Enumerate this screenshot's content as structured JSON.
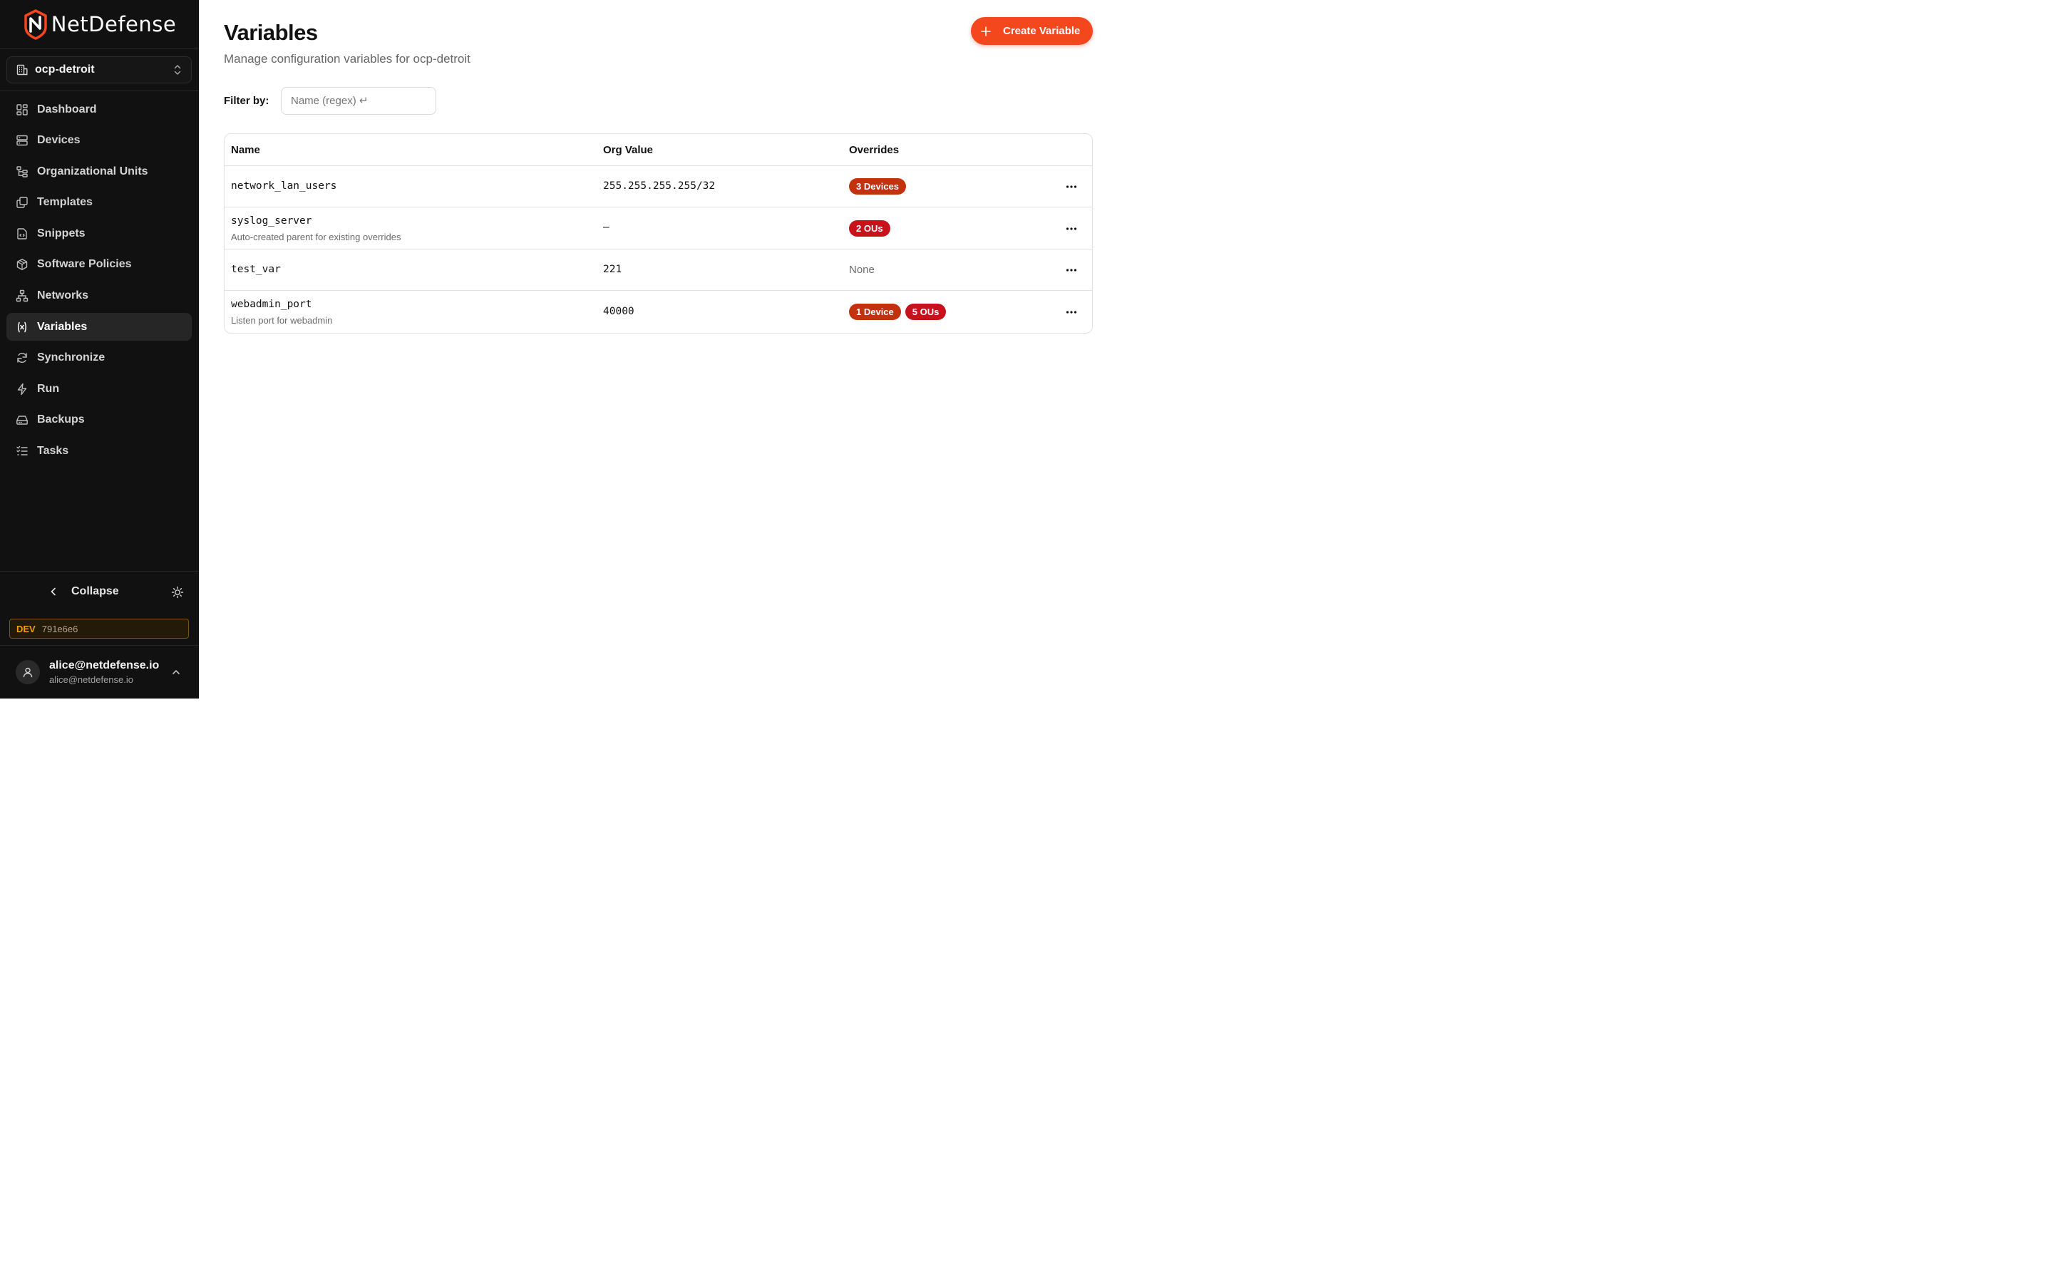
{
  "brand": {
    "name": "NetDefense"
  },
  "org_switcher": {
    "label": "ocp-detroit"
  },
  "nav": {
    "items": [
      {
        "label": "Dashboard",
        "icon": "dashboard-icon",
        "active": false
      },
      {
        "label": "Devices",
        "icon": "server-icon",
        "active": false
      },
      {
        "label": "Organizational Units",
        "icon": "tree-icon",
        "active": false
      },
      {
        "label": "Templates",
        "icon": "copy-icon",
        "active": false
      },
      {
        "label": "Snippets",
        "icon": "code-file-icon",
        "active": false
      },
      {
        "label": "Software Policies",
        "icon": "package-icon",
        "active": false
      },
      {
        "label": "Networks",
        "icon": "network-icon",
        "active": false
      },
      {
        "label": "Variables",
        "icon": "variable-icon",
        "active": true
      },
      {
        "label": "Synchronize",
        "icon": "refresh-icon",
        "active": false
      },
      {
        "label": "Run",
        "icon": "lightning-icon",
        "active": false
      },
      {
        "label": "Backups",
        "icon": "hard-drive-icon",
        "active": false
      },
      {
        "label": "Tasks",
        "icon": "list-check-icon",
        "active": false
      }
    ]
  },
  "sidebar_footer": {
    "collapse_label": "Collapse",
    "env": "DEV",
    "build_hash": "791e6e6",
    "user_name": "alice@netdefense.io",
    "user_email": "alice@netdefense.io"
  },
  "header": {
    "title": "Variables",
    "subtitle": "Manage configuration variables for ocp-detroit",
    "create_button": "Create Variable"
  },
  "filter": {
    "label": "Filter by:",
    "placeholder": "Name (regex) ↵",
    "value": ""
  },
  "table": {
    "columns": [
      "Name",
      "Org Value",
      "Overrides"
    ],
    "rows": [
      {
        "name": "network_lan_users",
        "description": "",
        "org_value": "255.255.255.255/32",
        "overrides": [
          {
            "text": "3 Devices",
            "kind": "device"
          }
        ]
      },
      {
        "name": "syslog_server",
        "description": "Auto-created parent for existing overrides",
        "org_value": "—",
        "overrides": [
          {
            "text": "2 OUs",
            "kind": "ou"
          }
        ]
      },
      {
        "name": "test_var",
        "description": "",
        "org_value": "221",
        "overrides": [],
        "none_text": "None"
      },
      {
        "name": "webadmin_port",
        "description": "Listen port for webadmin",
        "org_value": "40000",
        "overrides": [
          {
            "text": "1 Device",
            "kind": "device"
          },
          {
            "text": "5 OUs",
            "kind": "ou"
          }
        ]
      }
    ]
  },
  "colors": {
    "accent": "#f4471e",
    "sidebar_bg": "#111111",
    "device_badge": "#c2320f",
    "ou_badge": "#c8121b",
    "env_badge": "#f59e0b"
  }
}
